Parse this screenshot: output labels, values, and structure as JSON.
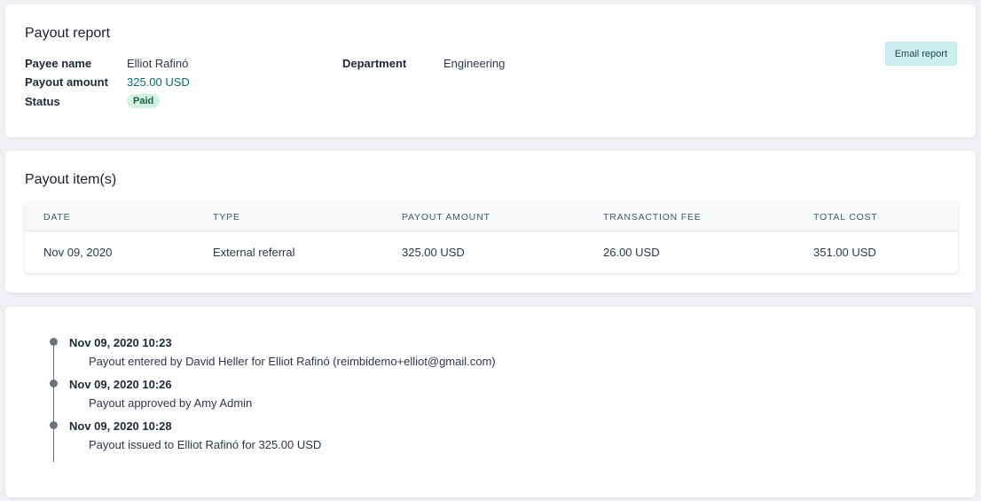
{
  "report": {
    "title": "Payout report",
    "payee_label": "Payee name",
    "payee_value": "Elliot Rafinó",
    "amount_label": "Payout amount",
    "amount_value": "325.00 USD",
    "status_label": "Status",
    "status_value": "Paid",
    "department_label": "Department",
    "department_value": "Engineering",
    "email_button": "Email report"
  },
  "items": {
    "title": "Payout item(s)",
    "columns": [
      "DATE",
      "TYPE",
      "PAYOUT AMOUNT",
      "TRANSACTION FEE",
      "TOTAL COST"
    ],
    "rows": [
      [
        "Nov 09, 2020",
        "External referral",
        "325.00 USD",
        "26.00 USD",
        "351.00 USD"
      ]
    ]
  },
  "timeline": [
    {
      "time": "Nov 09, 2020 10:23",
      "desc": "Payout entered by David Heller for Elliot Rafinó (reimbidemo+elliot@gmail.com)"
    },
    {
      "time": "Nov 09, 2020 10:26",
      "desc": "Payout approved by Amy Admin"
    },
    {
      "time": "Nov 09, 2020 10:28",
      "desc": "Payout issued to Elliot Rafinó for 325.00 USD"
    }
  ],
  "colors": {
    "accent": "#0e6b6b",
    "badge_bg": "#d1f2e3",
    "button_bg": "#cdeff0",
    "timeline": "#6b7280"
  }
}
